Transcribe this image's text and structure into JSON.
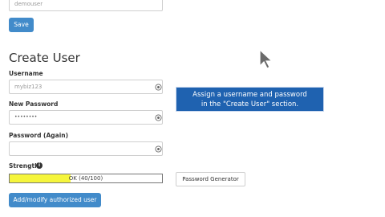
{
  "top_form": {
    "username_value": "demouser",
    "save_label": "Save"
  },
  "create_user": {
    "heading": "Create User",
    "username_label": "Username",
    "username_placeholder": "mybiz123",
    "password_label": "New Password",
    "password_masked": "••••••••",
    "password_again_label": "Password (Again)",
    "strength_label": "Strength",
    "strength_text": "OK (40/100)",
    "strength_percent": 40,
    "password_generator_label": "Password Generator",
    "add_modify_label": "Add/modify authorized user"
  },
  "tooltip": {
    "text_line1": "Assign a username and password",
    "text_line2": "in the \"Create User\" section."
  },
  "colors": {
    "primary": "#428bca",
    "strength_fill": "#f5f53c",
    "tooltip_bg": "#1f62b0"
  },
  "icons": {
    "field_icon": "eye-icon",
    "info_icon": "info-circle-icon",
    "cursor": "mouse-pointer-icon"
  }
}
